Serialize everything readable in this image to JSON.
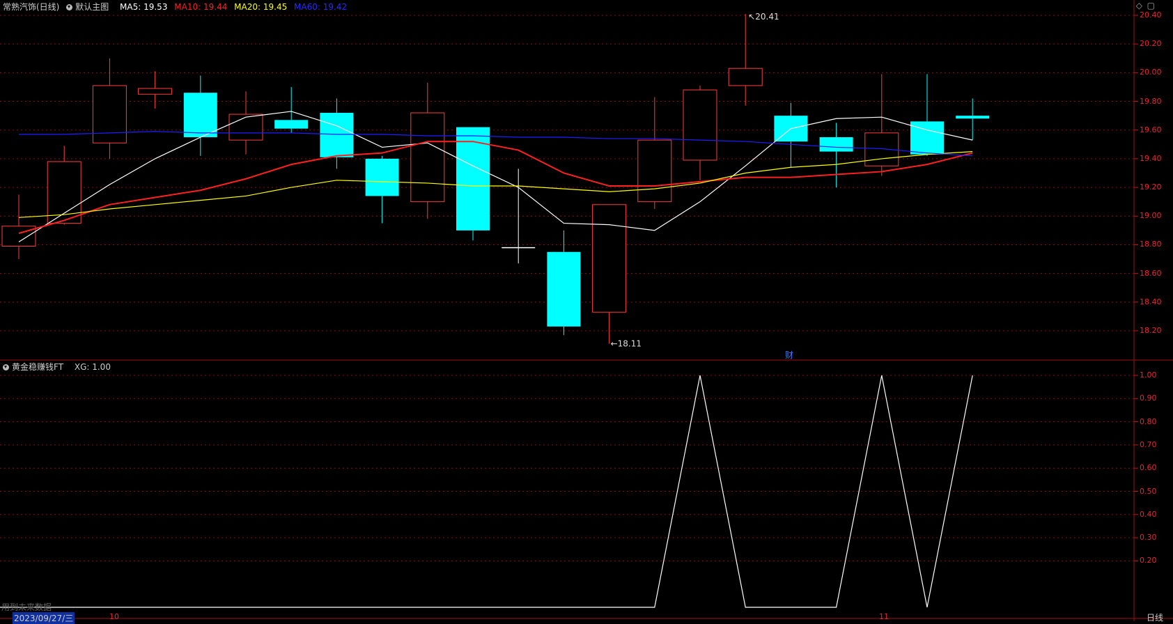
{
  "header": {
    "stock_name": "常熟汽饰(日线)",
    "main_chart_label": "默认主图",
    "ma5": {
      "label": "MA5: 19.53",
      "color": "#ffffff"
    },
    "ma10": {
      "label": "MA10: 19.44",
      "color": "#ff2020"
    },
    "ma20": {
      "label": "MA20: 19.45",
      "color": "#ffff00"
    },
    "ma60": {
      "label": "MA60: 19.42",
      "color": "#1e1eff"
    }
  },
  "sub_header": {
    "label": "黄金稳赚钱FT",
    "xg": "XG: 1.00"
  },
  "footer": {
    "date": "2023/09/27/三",
    "future_note": "用到未来数据",
    "month_10": "10",
    "month_11": "11",
    "period": "日线",
    "fin_marker": "财"
  },
  "chart_data": [
    {
      "type": "candlestick",
      "price_axis": {
        "min": 18.05,
        "max": 20.5,
        "ticks": [
          18.2,
          18.4,
          18.6,
          18.8,
          19.0,
          19.2,
          19.4,
          19.6,
          19.8,
          20.0,
          20.2,
          20.4
        ],
        "tick_labels": [
          "18.20",
          "18.40",
          "18.60",
          "18.80",
          "19.00",
          "19.20",
          "19.40",
          "19.60",
          "19.80",
          "20.00",
          "20.20",
          "20.40"
        ]
      },
      "annotations": {
        "high": "20.41",
        "low": "18.11"
      },
      "candles": [
        {
          "o": 18.79,
          "h": 19.15,
          "l": 18.7,
          "c": 18.93,
          "dir": "up"
        },
        {
          "o": 18.95,
          "h": 19.49,
          "l": 18.94,
          "c": 19.38,
          "dir": "up"
        },
        {
          "o": 19.51,
          "h": 20.1,
          "l": 19.4,
          "c": 19.91,
          "dir": "up"
        },
        {
          "o": 19.85,
          "h": 20.01,
          "l": 19.75,
          "c": 19.89,
          "dir": "up"
        },
        {
          "o": 19.86,
          "h": 19.98,
          "l": 19.42,
          "c": 19.55,
          "dir": "down"
        },
        {
          "o": 19.53,
          "h": 19.87,
          "l": 19.43,
          "c": 19.71,
          "dir": "up"
        },
        {
          "o": 19.67,
          "h": 19.9,
          "l": 19.58,
          "c": 19.61,
          "dir": "down"
        },
        {
          "o": 19.72,
          "h": 19.82,
          "l": 19.33,
          "c": 19.41,
          "dir": "down"
        },
        {
          "o": 19.4,
          "h": 19.42,
          "l": 18.95,
          "c": 19.14,
          "dir": "down"
        },
        {
          "o": 19.1,
          "h": 19.93,
          "l": 18.98,
          "c": 19.72,
          "dir": "up"
        },
        {
          "o": 19.62,
          "h": 19.62,
          "l": 18.83,
          "c": 18.9,
          "dir": "down"
        },
        {
          "o": 18.78,
          "h": 19.33,
          "l": 18.67,
          "c": 18.78,
          "dir": "doji"
        },
        {
          "o": 18.75,
          "h": 18.9,
          "l": 18.17,
          "c": 18.23,
          "dir": "down"
        },
        {
          "o": 18.33,
          "h": 19.08,
          "l": 18.11,
          "c": 19.08,
          "dir": "up"
        },
        {
          "o": 19.1,
          "h": 19.83,
          "l": 19.05,
          "c": 19.53,
          "dir": "up"
        },
        {
          "o": 19.39,
          "h": 19.91,
          "l": 19.25,
          "c": 19.88,
          "dir": "up"
        },
        {
          "o": 19.91,
          "h": 20.41,
          "l": 19.77,
          "c": 20.03,
          "dir": "up"
        },
        {
          "o": 19.7,
          "h": 19.79,
          "l": 19.34,
          "c": 19.52,
          "dir": "down"
        },
        {
          "o": 19.55,
          "h": 19.65,
          "l": 19.2,
          "c": 19.45,
          "dir": "down"
        },
        {
          "o": 19.35,
          "h": 19.99,
          "l": 19.28,
          "c": 19.58,
          "dir": "up"
        },
        {
          "o": 19.66,
          "h": 19.99,
          "l": 19.42,
          "c": 19.43,
          "dir": "down"
        },
        {
          "o": 19.7,
          "h": 19.82,
          "l": 19.53,
          "c": 19.68,
          "dir": "down"
        }
      ],
      "series": [
        {
          "name": "MA5",
          "color": "#ffffff",
          "values": [
            18.82,
            19.02,
            19.22,
            19.4,
            19.55,
            19.69,
            19.73,
            19.63,
            19.48,
            19.51,
            19.35,
            19.2,
            18.95,
            18.94,
            18.9,
            19.1,
            19.35,
            19.61,
            19.68,
            19.69,
            19.6,
            19.53
          ]
        },
        {
          "name": "MA10",
          "color": "#ff2020",
          "values": [
            18.88,
            18.97,
            19.08,
            19.13,
            19.18,
            19.26,
            19.36,
            19.42,
            19.44,
            19.52,
            19.52,
            19.46,
            19.3,
            19.21,
            19.21,
            19.24,
            19.27,
            19.27,
            19.29,
            19.31,
            19.36,
            19.44
          ]
        },
        {
          "name": "MA20",
          "color": "#ffff00",
          "values": [
            18.99,
            19.01,
            19.05,
            19.08,
            19.11,
            19.14,
            19.2,
            19.25,
            19.24,
            19.23,
            19.21,
            19.21,
            19.19,
            19.17,
            19.19,
            19.23,
            19.3,
            19.34,
            19.36,
            19.4,
            19.43,
            19.45
          ]
        },
        {
          "name": "MA60",
          "color": "#1e1eff",
          "values": [
            19.57,
            19.57,
            19.58,
            19.59,
            19.58,
            19.58,
            19.58,
            19.57,
            19.57,
            19.56,
            19.56,
            19.55,
            19.55,
            19.54,
            19.54,
            19.53,
            19.52,
            19.5,
            19.48,
            19.47,
            19.44,
            19.42
          ]
        }
      ]
    },
    {
      "type": "line",
      "value_axis": {
        "min": 0,
        "max": 1.0,
        "ticks": [
          0.2,
          0.3,
          0.4,
          0.5,
          0.6,
          0.7,
          0.8,
          0.9,
          1.0
        ],
        "tick_labels": [
          "0.20",
          "0.30",
          "0.40",
          "0.50",
          "0.60",
          "0.70",
          "0.80",
          "0.90",
          "1.00"
        ]
      },
      "series": [
        {
          "name": "XG",
          "color": "#ffffff",
          "values": [
            0,
            0,
            0,
            0,
            0,
            0,
            0,
            0,
            0,
            0,
            0,
            0,
            0,
            0,
            0,
            1,
            0,
            0,
            0,
            1,
            0,
            1
          ]
        }
      ]
    }
  ]
}
